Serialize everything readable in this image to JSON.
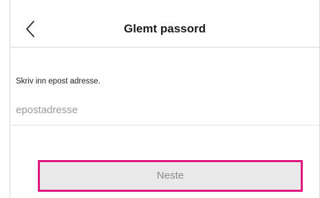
{
  "header": {
    "title": "Glemt passord",
    "back_icon": "chevron-left-icon"
  },
  "form": {
    "instruction": "Skriv inn epost adresse.",
    "email_placeholder": "epostadresse",
    "email_value": ""
  },
  "actions": {
    "next_label": "Neste"
  },
  "colors": {
    "highlight": "#e0157f",
    "button_bg": "#e9e9e9",
    "button_text": "#8a8a8a",
    "placeholder": "#9a9aa0",
    "divider": "#d9d9d9"
  }
}
